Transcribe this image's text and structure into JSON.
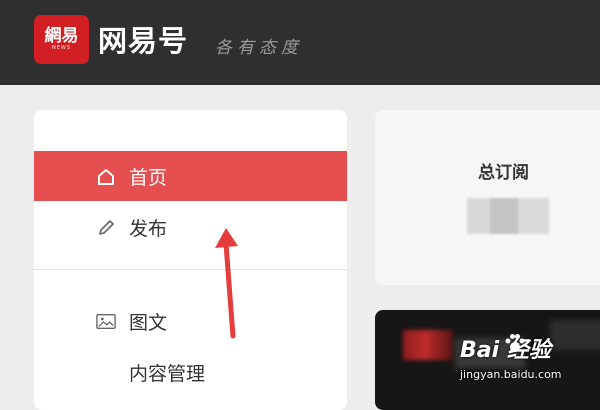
{
  "header": {
    "logo_cn": "網易",
    "logo_en": "NEWS",
    "brand": "网易号",
    "slogan": "各有态度"
  },
  "sidebar": {
    "items": [
      {
        "label": "首页",
        "icon": "home-icon",
        "active": true
      },
      {
        "label": "发布",
        "icon": "pencil-icon",
        "active": false
      },
      {
        "label": "图文",
        "icon": "image-icon",
        "active": false
      },
      {
        "label": "内容管理",
        "icon": "",
        "active": false
      }
    ]
  },
  "summary": {
    "subscriptions_title": "总订阅"
  },
  "watermark": {
    "logo_text": "Bai  经验",
    "url": "jingyan.baidu.com"
  },
  "colors": {
    "header_bg": "#2f2f2f",
    "brand_red": "#d21f24",
    "active_nav": "#e54f4f",
    "annotation_arrow": "#e53c3c"
  }
}
